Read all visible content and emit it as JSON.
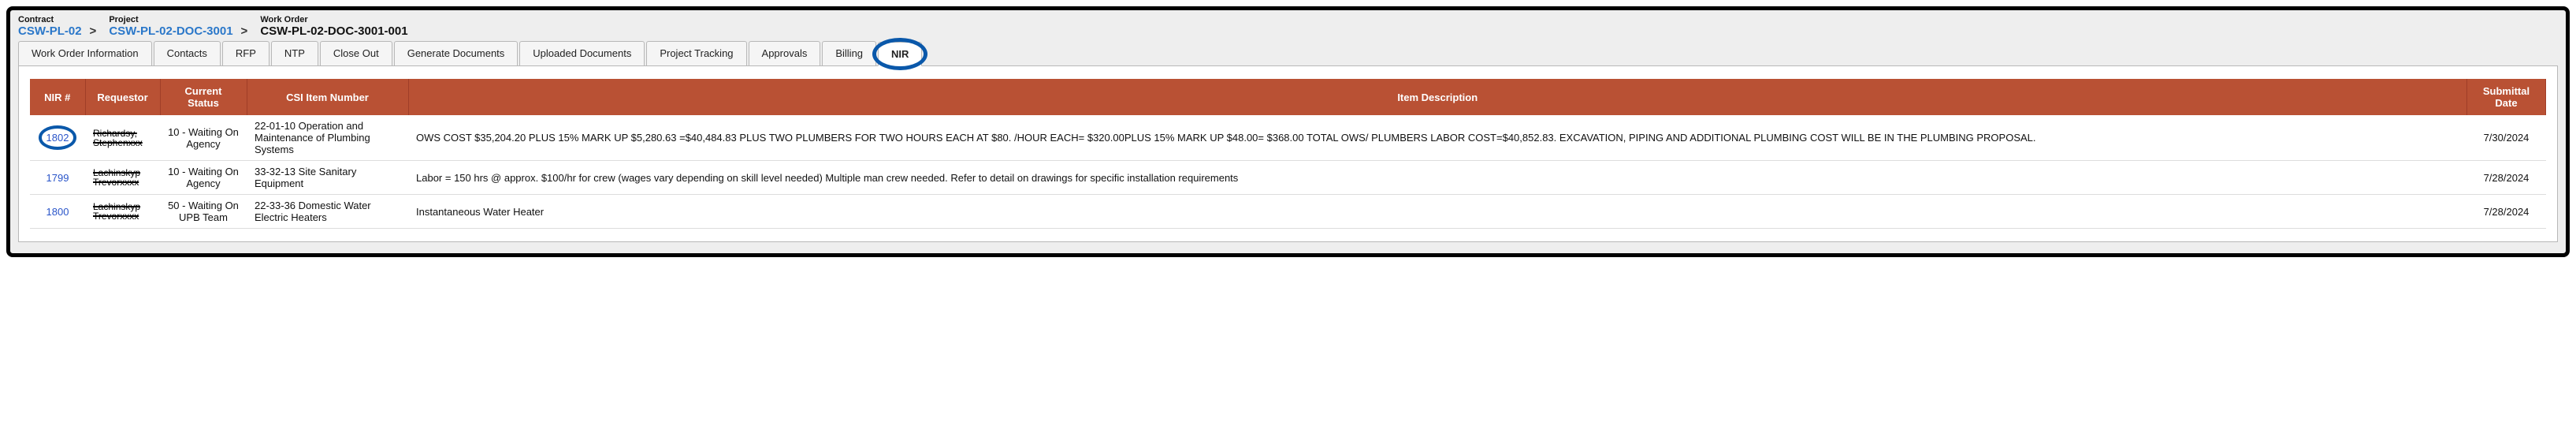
{
  "breadcrumb": {
    "contract_label": "Contract",
    "contract_value": "CSW-PL-02",
    "project_label": "Project",
    "project_value": "CSW-PL-02-DOC-3001",
    "wo_label": "Work Order",
    "wo_value": "CSW-PL-02-DOC-3001-001",
    "sep": ">"
  },
  "tabs": [
    "Work Order Information",
    "Contacts",
    "RFP",
    "NTP",
    "Close Out",
    "Generate Documents",
    "Uploaded Documents",
    "Project Tracking",
    "Approvals",
    "Billing",
    "NIR"
  ],
  "table": {
    "headers": {
      "nir": "NIR #",
      "requestor": "Requestor",
      "status": "Current Status",
      "csi": "CSI Item Number",
      "desc": "Item Description",
      "date": "Submittal Date"
    },
    "rows": [
      {
        "nir": "1802",
        "nir_highlight": true,
        "requestor_l1": "Richardsy,",
        "requestor_l2": "Stephenxxx",
        "status": "10 - Waiting On Agency",
        "csi": "22-01-10   Operation and Maintenance of Plumbing Systems",
        "desc": "OWS COST $35,204.20 PLUS 15% MARK UP $5,280.63 =$40,484.83 PLUS TWO PLUMBERS FOR TWO HOURS EACH AT $80. /HOUR EACH= $320.00PLUS 15% MARK UP $48.00= $368.00 TOTAL OWS/ PLUMBERS LABOR COST=$40,852.83. EXCAVATION, PIPING AND ADDITIONAL PLUMBING COST WILL BE IN THE PLUMBING PROPOSAL.",
        "date": "7/30/2024"
      },
      {
        "nir": "1799",
        "nir_highlight": false,
        "requestor_l1": "Lachinskyp",
        "requestor_l2": "Trevorxxxx",
        "status": "10 - Waiting On Agency",
        "csi": "33-32-13   Site Sanitary Equipment",
        "desc": "Labor = 150 hrs @ approx. $100/hr for crew (wages vary depending on skill level needed) Multiple man crew needed. Refer to detail on drawings for specific installation requirements",
        "date": "7/28/2024"
      },
      {
        "nir": "1800",
        "nir_highlight": false,
        "requestor_l1": "Lachinskyp",
        "requestor_l2": "Trevorxxxx",
        "status": "50 - Waiting On UPB Team",
        "csi": "22-33-36   Domestic Water Electric Heaters",
        "desc": "Instantaneous Water Heater",
        "date": "7/28/2024"
      }
    ]
  }
}
